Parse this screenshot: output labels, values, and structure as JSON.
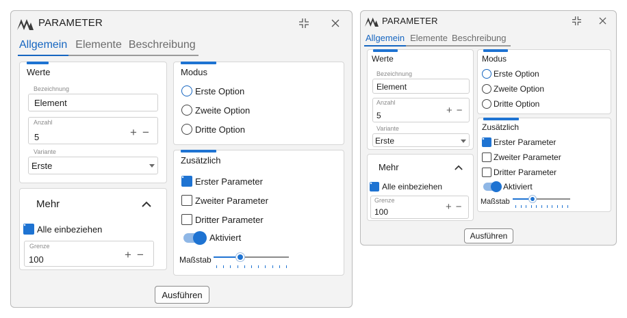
{
  "dialogs": [
    {
      "title": "PARAMETER",
      "tabs": [
        "Allgemein",
        "Elemente",
        "Beschreibung"
      ],
      "active_tab": "Allgemein",
      "werte": {
        "title": "Werte",
        "bezeichnung": {
          "label": "Bezeichnung",
          "value": "Element"
        },
        "anzahl": {
          "label": "Anzahl",
          "value": "5"
        },
        "variante": {
          "label": "Variante",
          "value": "Erste"
        }
      },
      "mehr": {
        "title": "Mehr",
        "alle_label": "Alle einbeziehen",
        "alle_checked": true,
        "grenze": {
          "label": "Grenze",
          "value": "100"
        }
      },
      "modus": {
        "title": "Modus",
        "options": [
          "Erste Option",
          "Zweite Option",
          "Dritte Option"
        ],
        "selected": 0
      },
      "zusaetzlich": {
        "title": "Zusätzlich",
        "checks": [
          {
            "label": "Erster Parameter",
            "checked": true
          },
          {
            "label": "Zweiter Parameter",
            "checked": false
          },
          {
            "label": "Dritter Parameter",
            "checked": false
          }
        ],
        "toggle_label": "Aktiviert",
        "toggle_on": true,
        "slider_label": "Maßstab",
        "slider_value": 0.35
      },
      "run_button": "Ausführen"
    },
    {
      "title": "PARAMETER",
      "tabs": [
        "Allgemein",
        "Elemente",
        "Beschreibung"
      ],
      "active_tab": "Allgemein",
      "werte": {
        "title": "Werte",
        "bezeichnung": {
          "label": "Bezeichnung",
          "value": "Element"
        },
        "anzahl": {
          "label": "Anzahl",
          "value": "5"
        },
        "variante": {
          "label": "Variante",
          "value": "Erste"
        }
      },
      "mehr": {
        "title": "Mehr",
        "alle_label": "Alle einbeziehen",
        "alle_checked": true,
        "grenze": {
          "label": "Grenze",
          "value": "100"
        }
      },
      "modus": {
        "title": "Modus",
        "options": [
          "Erste Option",
          "Zweite Option",
          "Dritte Option"
        ],
        "selected": 0
      },
      "zusaetzlich": {
        "title": "Zusätzlich",
        "checks": [
          {
            "label": "Erster Parameter",
            "checked": true
          },
          {
            "label": "Zweiter Parameter",
            "checked": false
          },
          {
            "label": "Dritter Parameter",
            "checked": false
          }
        ],
        "toggle_label": "Aktiviert",
        "toggle_on": true,
        "slider_label": "Maßstab",
        "slider_value": 0.35
      },
      "run_button": "Ausführen"
    }
  ],
  "colors": {
    "accent": "#1e73d2",
    "tab_active": "#1565c0",
    "dialog_bg": "#f3f3f3"
  },
  "icons": [
    "app-logo-icon",
    "collapse-icon",
    "close-icon",
    "plus-icon",
    "minus-icon",
    "chevron-down-icon",
    "chevron-up-icon",
    "check-icon"
  ]
}
